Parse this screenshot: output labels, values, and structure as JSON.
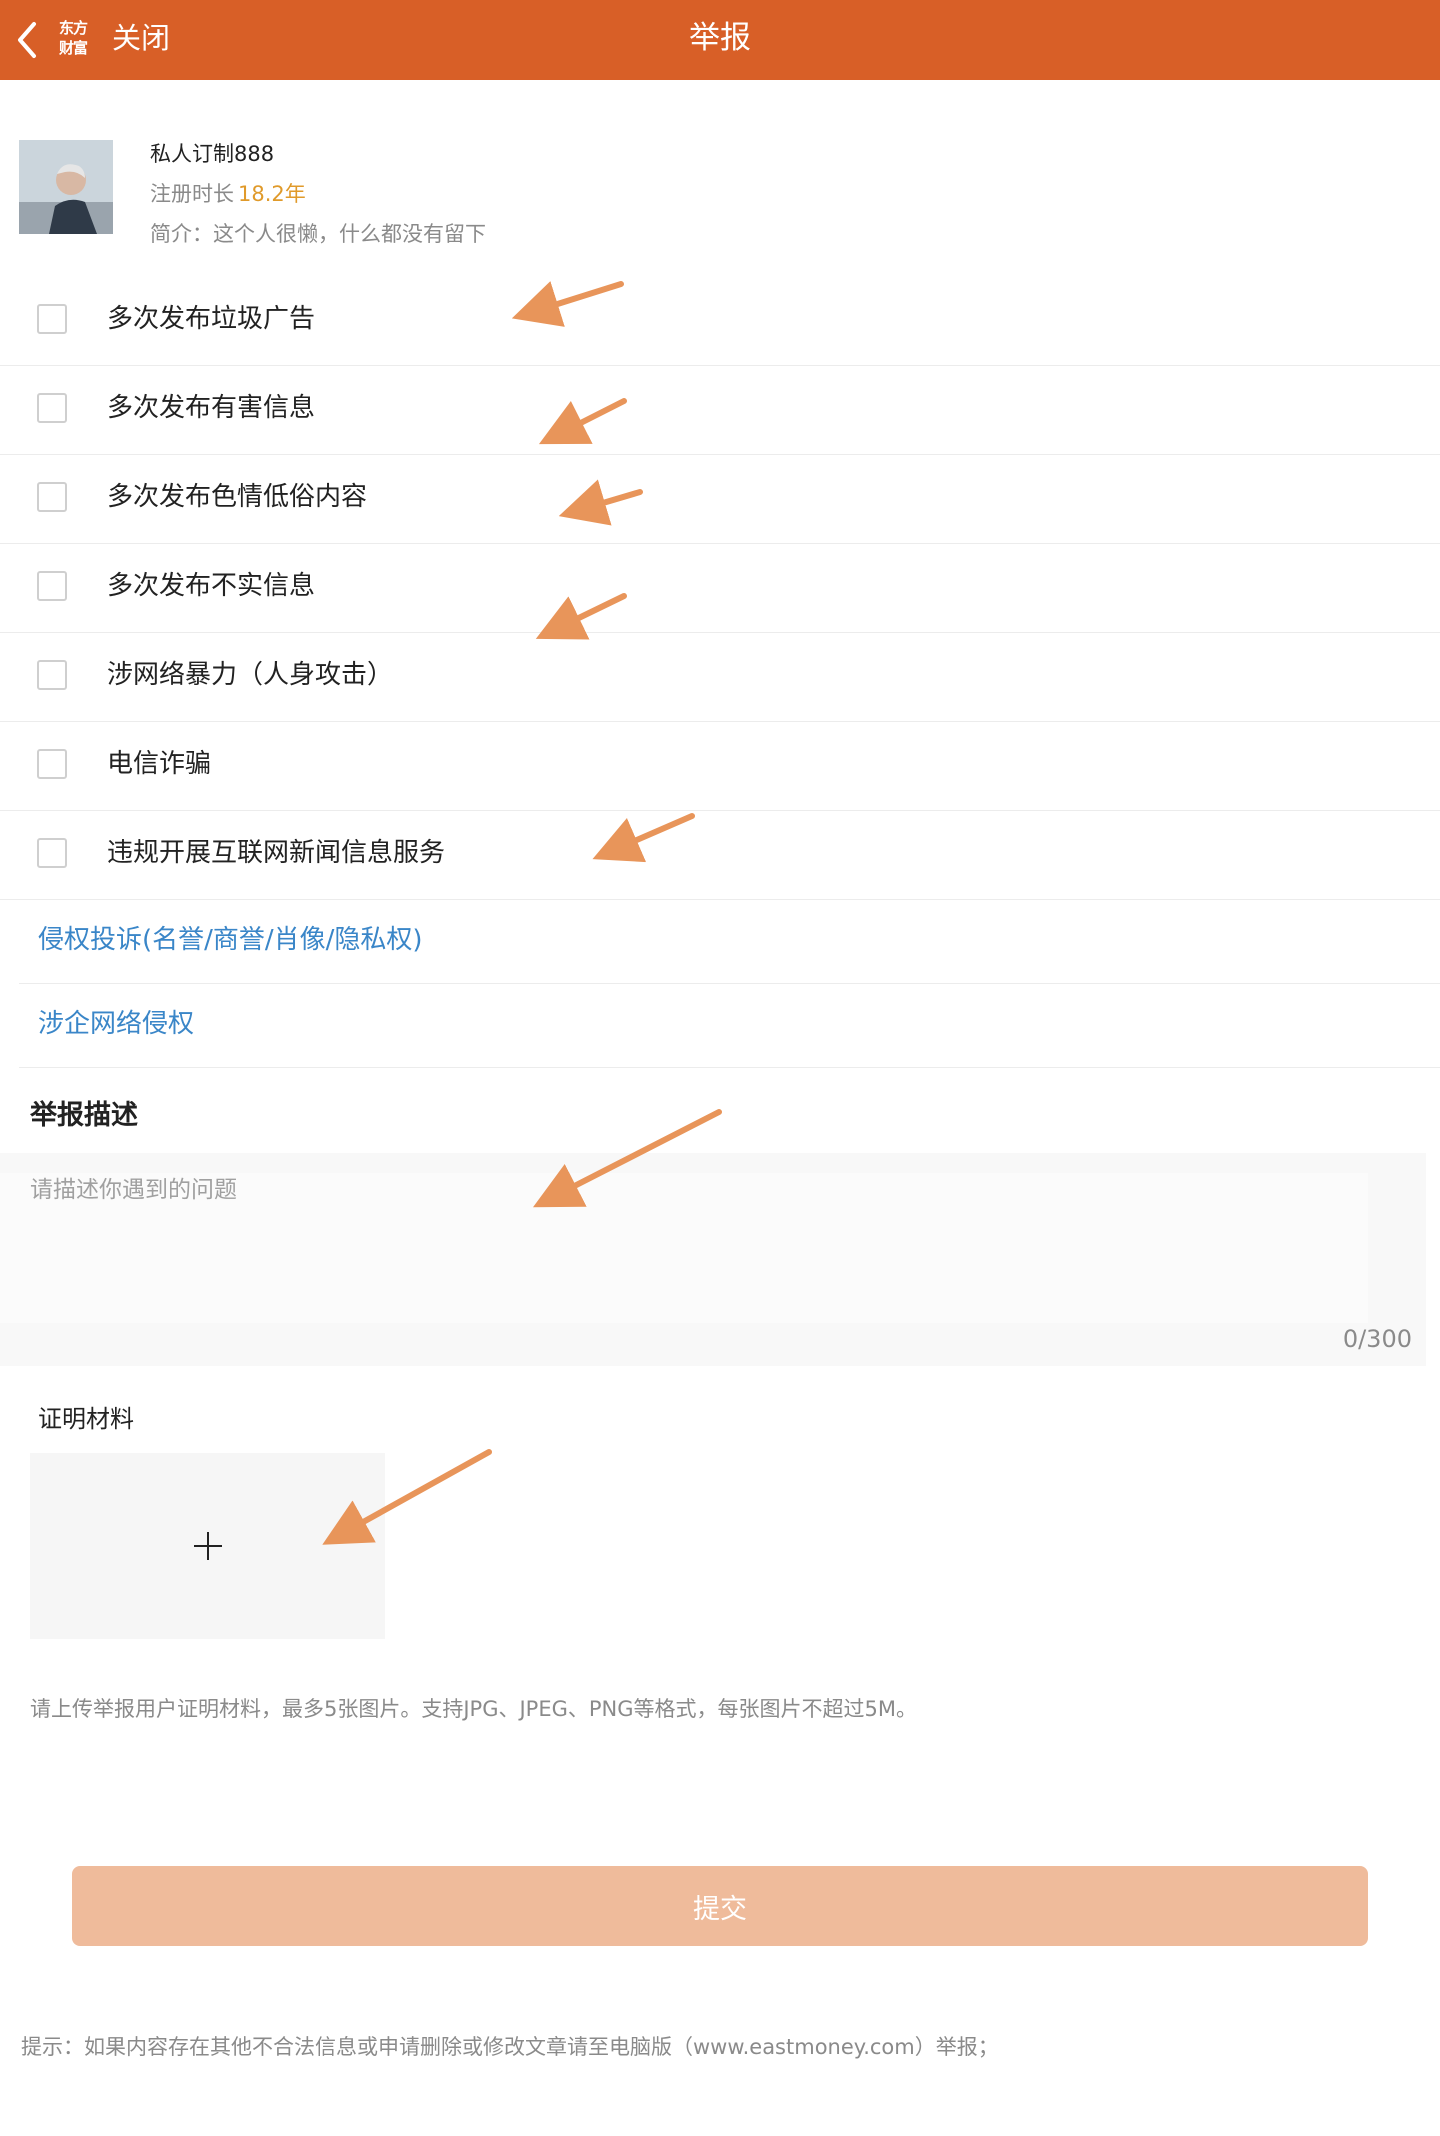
{
  "header": {
    "logo_lines": [
      "东方",
      "财富"
    ],
    "close_label": "关闭",
    "title": "举报"
  },
  "profile": {
    "username": "私人订制888",
    "reg_label": "注册时长",
    "reg_value": "18.2年",
    "bio": "简介：这个人很懒，什么都没有留下"
  },
  "options": [
    {
      "label": "多次发布垃圾广告",
      "checked": false
    },
    {
      "label": "多次发布有害信息",
      "checked": false
    },
    {
      "label": "多次发布色情低俗内容",
      "checked": false
    },
    {
      "label": "多次发布不实信息",
      "checked": false
    },
    {
      "label": "涉网络暴力（人身攻击）",
      "checked": false
    },
    {
      "label": "电信诈骗",
      "checked": false
    },
    {
      "label": "违规开展互联网新闻信息服务",
      "checked": false
    }
  ],
  "links": [
    {
      "label": "侵权投诉(名誉/商誉/肖像/隐私权)"
    },
    {
      "label": "涉企网络侵权"
    }
  ],
  "description": {
    "title": "举报描述",
    "placeholder": "请描述你遇到的问题",
    "value": "",
    "counter": "0/300"
  },
  "proof": {
    "title": "证明材料",
    "hint": "请上传举报用户证明材料，最多5张图片。支持JPG、JPEG、PNG等格式，每张图片不超过5M。"
  },
  "submit_label": "提交",
  "footer_tip": "提示：如果内容存在其他不合法信息或申请删除或修改文章请至电脑版（www.eastmoney.com）举报；",
  "colors": {
    "header_bg": "#d85f27",
    "submit_bg": "#efbb9b",
    "link": "#3a86c8",
    "reg_value": "#e09a2a",
    "annotation_arrow": "#e8955a"
  }
}
